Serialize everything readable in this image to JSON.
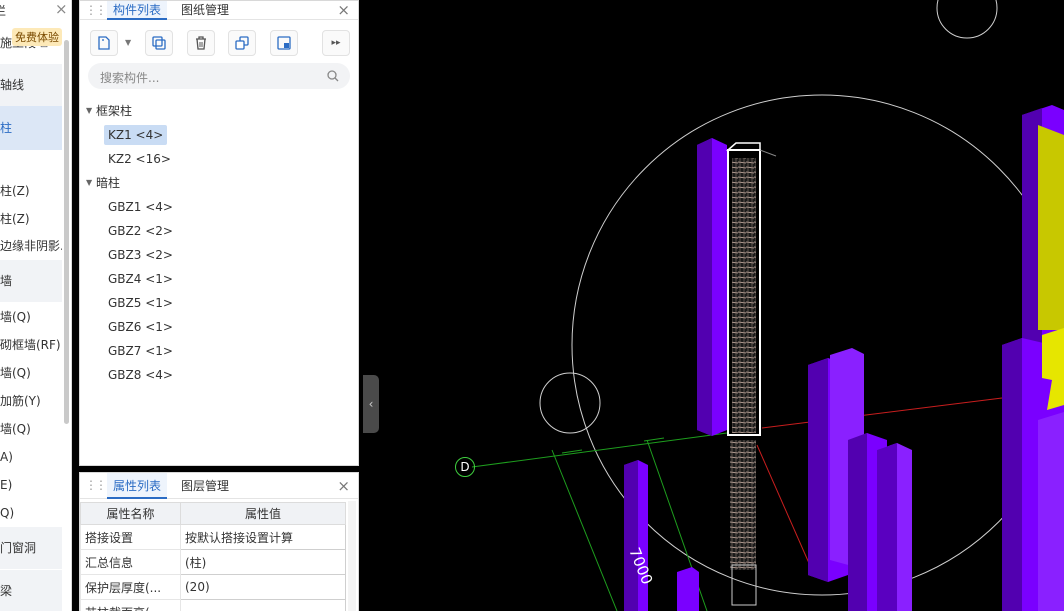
{
  "nav": {
    "title": "栏",
    "free_badge": "免费体验",
    "items": [
      {
        "label": "施工段"
      },
      {
        "label": "轴线"
      },
      {
        "label": "柱"
      },
      {
        "label": "柱(Z)"
      },
      {
        "label": "柱(Z)"
      },
      {
        "label": "边缘非阴影..."
      },
      {
        "label": "墙"
      },
      {
        "label": "墙(Q)"
      },
      {
        "label": "砌框墙(RF)"
      },
      {
        "label": "墙(Q)"
      },
      {
        "label": "加筋(Y)"
      },
      {
        "label": "墙(Q)"
      },
      {
        "label": "A)"
      },
      {
        "label": "E)"
      },
      {
        "label": "Q)"
      },
      {
        "label": "门窗洞"
      },
      {
        "label": "梁"
      }
    ]
  },
  "component_panel": {
    "tabs": [
      {
        "label": "构件列表"
      },
      {
        "label": "图纸管理"
      }
    ],
    "search_placeholder": "搜索构件...",
    "groups": [
      {
        "label": "框架柱",
        "items": [
          {
            "label": "KZ1 <4>",
            "selected": true
          },
          {
            "label": "KZ2 <16>"
          }
        ]
      },
      {
        "label": "暗柱",
        "items": [
          {
            "label": "GBZ1 <4>"
          },
          {
            "label": "GBZ2 <2>"
          },
          {
            "label": "GBZ3 <2>"
          },
          {
            "label": "GBZ4 <1>"
          },
          {
            "label": "GBZ5 <1>"
          },
          {
            "label": "GBZ6 <1>"
          },
          {
            "label": "GBZ7 <1>"
          },
          {
            "label": "GBZ8 <4>"
          }
        ]
      }
    ]
  },
  "property_panel": {
    "tabs": [
      {
        "label": "属性列表"
      },
      {
        "label": "图层管理"
      }
    ],
    "columns": [
      "属性名称",
      "属性值"
    ],
    "rows": [
      {
        "name": "搭接设置",
        "value": "按默认搭接设置计算"
      },
      {
        "name": "汇总信息",
        "value": "(柱)"
      },
      {
        "name": "保护层厚度(...",
        "value": "(20)"
      },
      {
        "name": "芯柱截面高(",
        "value": ""
      }
    ]
  },
  "viewport": {
    "axis_label": "D",
    "dimension_label": "7000",
    "colors": {
      "column": "#7a00ff",
      "column_dark": "#5200b0",
      "column_light": "#9a3bff",
      "wall": "#c8c800",
      "selected_outline": "#ffffff",
      "rebar": "#b09a90",
      "axis_green": "#1e9e1e",
      "axis_red": "#c81e1e",
      "circle": "#d0d0d0"
    }
  }
}
